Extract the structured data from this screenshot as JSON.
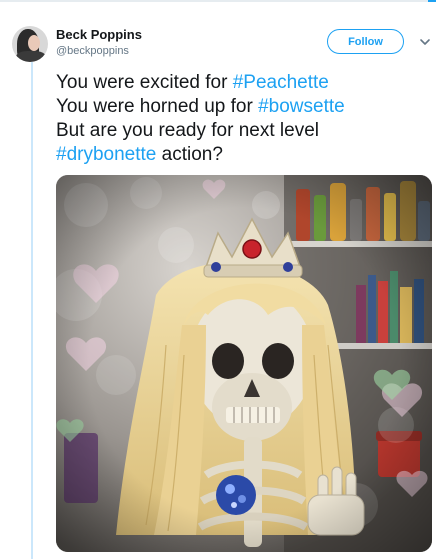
{
  "tweet": {
    "author": {
      "name": "Beck Poppins",
      "handle": "@beckpoppins"
    },
    "follow_label": "Follow",
    "text": {
      "line1_prefix": "You were excited for ",
      "line1_hashtag": "#Peachette",
      "line2_prefix": "You were horned up for ",
      "line2_hashtag": "#bowsette",
      "line3": "But are you ready for next level",
      "line4_hashtag": "#drybonette",
      "line4_suffix": " action?"
    }
  },
  "colors": {
    "link": "#1da1f2",
    "text": "#14171a",
    "muted": "#657786",
    "thread_line": "#cbe7fb"
  },
  "icons": {
    "caret": "chevron-down-icon"
  }
}
